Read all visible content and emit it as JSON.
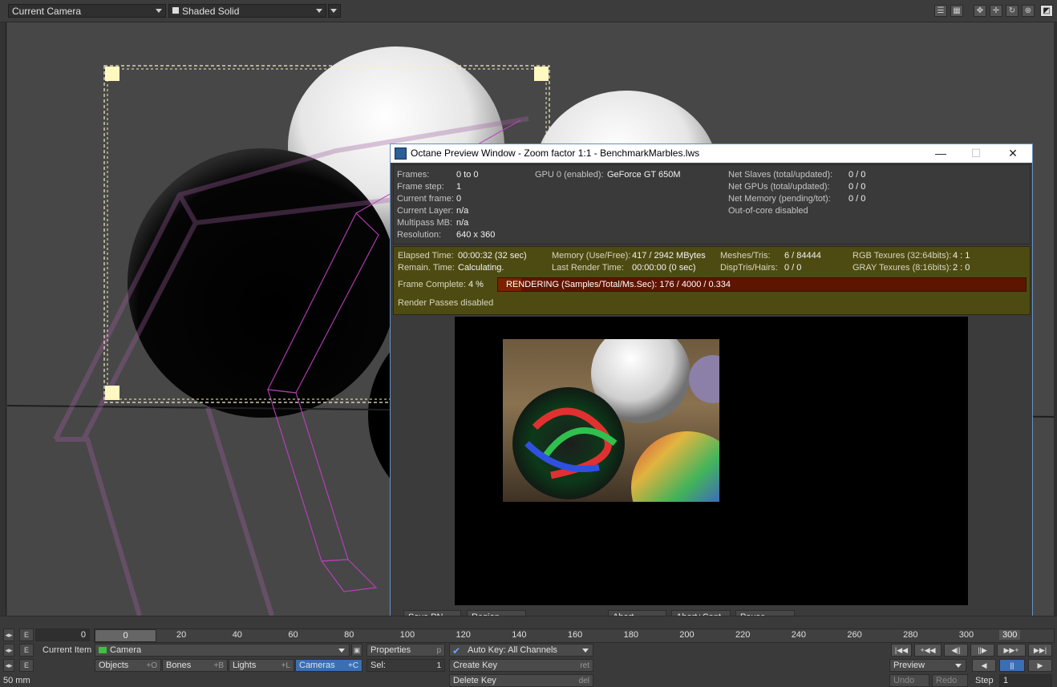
{
  "topbar": {
    "view_mode": "Current Camera",
    "shading": "Shaded Solid"
  },
  "octane": {
    "title": "Octane Preview Window - Zoom factor 1:1 - BenchmarkMarbles.lws",
    "info_left": [
      {
        "label": "Frames:",
        "value": "0 to 0"
      },
      {
        "label": "Frame step:",
        "value": "1"
      },
      {
        "label": "Current frame:",
        "value": "0"
      },
      {
        "label": "Current Layer:",
        "value": "n/a"
      },
      {
        "label": "Multipass MB:",
        "value": "n/a"
      },
      {
        "label": "Resolution:",
        "value": "640 x 360"
      }
    ],
    "gpu_label": "GPU  0 (enabled):",
    "gpu_value": "GeForce GT 650M",
    "info_right": [
      {
        "label": "Net Slaves (total/updated):",
        "value": "0 / 0"
      },
      {
        "label": "Net GPUs (total/updated):",
        "value": "0 / 0"
      },
      {
        "label": "Net Memory (pending/tot):",
        "value": "0 / 0"
      },
      {
        "label": "Out-of-core disabled",
        "value": ""
      }
    ],
    "stats": {
      "elapsed_label": "Elapsed Time:",
      "elapsed_value": "00:00:32 (32 sec)",
      "remain_label": "Remain. Time:",
      "remain_value": "Calculating.",
      "memory_label": "Memory (Use/Free):",
      "memory_value": "417 / 2942 MBytes",
      "lastrender_label": "Last Render Time:",
      "lastrender_value": "00:00:00 (0 sec)",
      "meshes_label": "Meshes/Tris:",
      "meshes_value": "6 / 84444",
      "disptris_label": "DispTris/Hairs:",
      "disptris_value": "0 / 0",
      "rgb_label": "RGB Texures (32:64bits):",
      "rgb_value": "4 : 1",
      "gray_label": "GRAY Texures (8:16bits):",
      "gray_value": "2 : 0",
      "frame_complete_label": "Frame Complete:",
      "frame_complete_value": "4 %",
      "progress_fraction": 0.044,
      "rendering_text": "RENDERING (Samples/Total/Ms.Sec): 176 / 4000 / 0.334",
      "passes": "Render Passes disabled"
    },
    "buttons": {
      "save": "Save PN...",
      "region": "Region",
      "abort": "Abort",
      "abort_cont": "Abort+Cont.",
      "pause": "Pause"
    }
  },
  "timeline": {
    "frame": "0",
    "slider_frame": "0",
    "ticks": [
      "20",
      "40",
      "60",
      "80",
      "100",
      "120",
      "140",
      "160",
      "180",
      "200",
      "220",
      "240",
      "260",
      "280",
      "300"
    ],
    "end_frame": "300"
  },
  "bottom": {
    "current_item_label": "Current Item",
    "current_item": "Camera",
    "properties": "Properties",
    "properties_key": "p",
    "auto_key": "Auto Key: All Channels",
    "objects": "Objects",
    "objects_key": "+O",
    "bones": "Bones",
    "bones_key": "+B",
    "lights": "Lights",
    "lights_key": "+L",
    "cameras": "Cameras",
    "cameras_key": "+C",
    "sel_label": "Sel:",
    "sel_value": "1",
    "create_key": "Create Key",
    "create_key_hint": "ret",
    "delete_key": "Delete Key",
    "delete_key_hint": "del",
    "preview": "Preview",
    "undo": "Undo",
    "redo": "Redo",
    "step_label": "Step",
    "step_value": "1",
    "lens": "50 mm",
    "e_label": "E"
  },
  "colors": {
    "accent": "#3a6fb5",
    "stat_bg": "#4e4b12",
    "progress": "#5f1400",
    "wire": "#c040c0"
  }
}
